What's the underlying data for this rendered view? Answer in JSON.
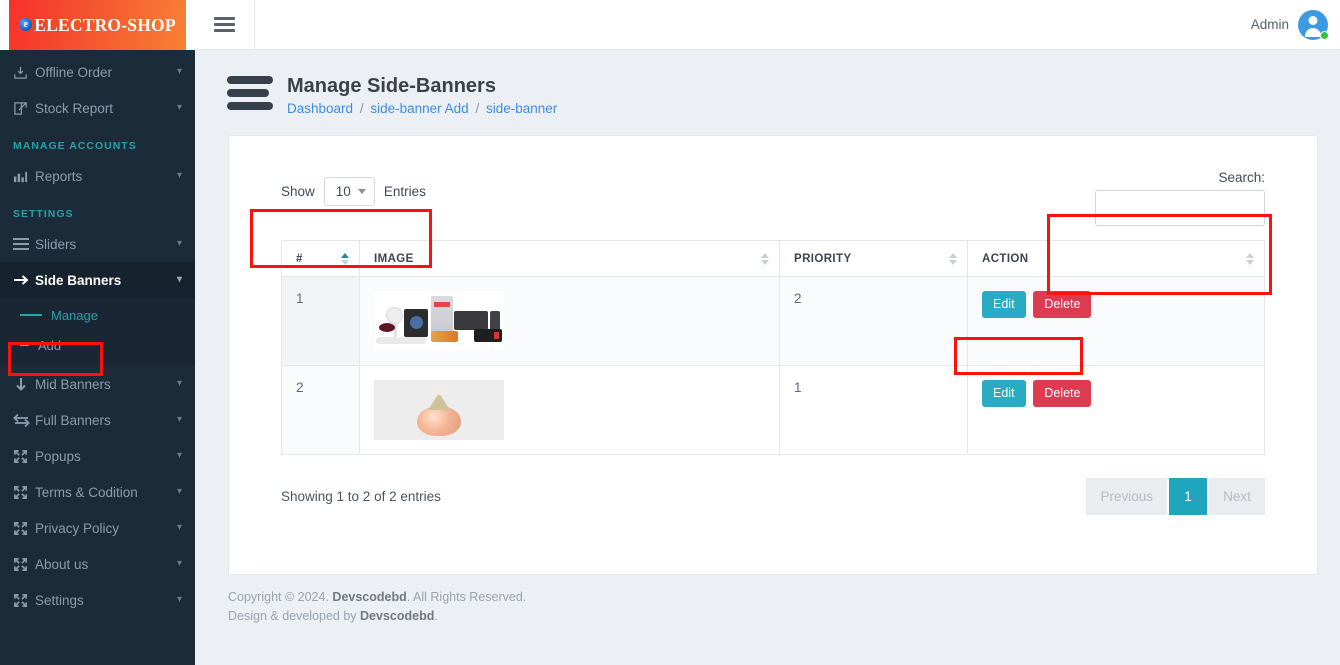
{
  "brand": {
    "logo_e": "e",
    "logo_text": "ELECTRO-SHOP"
  },
  "sidebar": {
    "items": [
      {
        "label": "Offline Order",
        "icon": "download-box-icon",
        "chevron": "⌄"
      },
      {
        "label": "Stock Report",
        "icon": "edit-square-icon",
        "chevron": "⌄"
      }
    ],
    "heading_accounts": "MANAGE ACCOUNTS",
    "reports": {
      "label": "Reports",
      "icon": "bar-chart-icon",
      "chevron": "⌄"
    },
    "heading_settings": "SETTINGS",
    "settings_items": [
      {
        "label": "Sliders",
        "icon": "list-lines-icon",
        "chevron": "⌄"
      },
      {
        "label": "Side Banners",
        "icon": "arrow-right-icon",
        "chevron": "⌄",
        "active": true
      },
      {
        "label": "Mid Banners",
        "icon": "arrow-down-icon",
        "chevron": "⌄"
      },
      {
        "label": "Full Banners",
        "icon": "arrows-exchange-icon",
        "chevron": "⌄"
      },
      {
        "label": "Popups",
        "icon": "expand-icon",
        "chevron": "⌄"
      },
      {
        "label": "Terms & Codition",
        "icon": "expand-icon",
        "chevron": "⌄"
      },
      {
        "label": "Privacy Policy",
        "icon": "expand-icon",
        "chevron": "⌄"
      },
      {
        "label": "About us",
        "icon": "expand-icon",
        "chevron": "⌄"
      },
      {
        "label": "Settings",
        "icon": "expand-icon",
        "chevron": "⌄"
      }
    ],
    "side_banner_submenu": [
      {
        "label": "Manage",
        "current": true
      },
      {
        "label": "Add",
        "current": false
      }
    ]
  },
  "topbar": {
    "menu_toggle": "hamburger-icon",
    "admin_label": "Admin",
    "avatar": "user-avatar",
    "status": "online"
  },
  "page": {
    "title": "Manage Side-Banners",
    "breadcrumbs": [
      {
        "label": "Dashboard"
      },
      {
        "label": "side-banner Add"
      },
      {
        "label": "side-banner"
      }
    ],
    "breadcrumb_separator": "/"
  },
  "table_controls": {
    "show_label": "Show",
    "entries_label": "Entries",
    "page_length": "10",
    "search_label": "Search:",
    "search_value": "",
    "search_placeholder": ""
  },
  "table": {
    "columns": [
      {
        "label": "#",
        "sort": "asc"
      },
      {
        "label": "IMAGE",
        "sort": "none"
      },
      {
        "label": "PRIORITY",
        "sort": "none"
      },
      {
        "label": "ACTION",
        "sort": "none"
      }
    ],
    "rows": [
      {
        "index": "1",
        "image": "home-appliances-collage-banner",
        "priority": "2",
        "edit_label": "Edit",
        "delete_label": "Delete"
      },
      {
        "index": "2",
        "image": "perfume-bottle-banner",
        "priority": "1",
        "edit_label": "Edit",
        "delete_label": "Delete"
      }
    ]
  },
  "table_footer": {
    "info": "Showing 1 to 2 of 2 entries",
    "previous_label": "Previous",
    "page_1_label": "1",
    "next_label": "Next"
  },
  "footer": {
    "copyright_pre": "Copyright © 2024. ",
    "copyright_brand": "Devscodebd",
    "copyright_post": ". All Rights Reserved.",
    "credit_pre": "Design & developed by ",
    "credit_brand": "Devscodebd",
    "credit_post": "."
  },
  "colors": {
    "sidebar_bg": "#1c2b3a",
    "accent_teal": "#2aa0a8",
    "edit_button": "#2aabc4",
    "delete_button": "#dc3b52",
    "pager_active": "#21a5bd",
    "annotation": "#fc1208",
    "breadcrumb_link": "#3c8dde"
  }
}
